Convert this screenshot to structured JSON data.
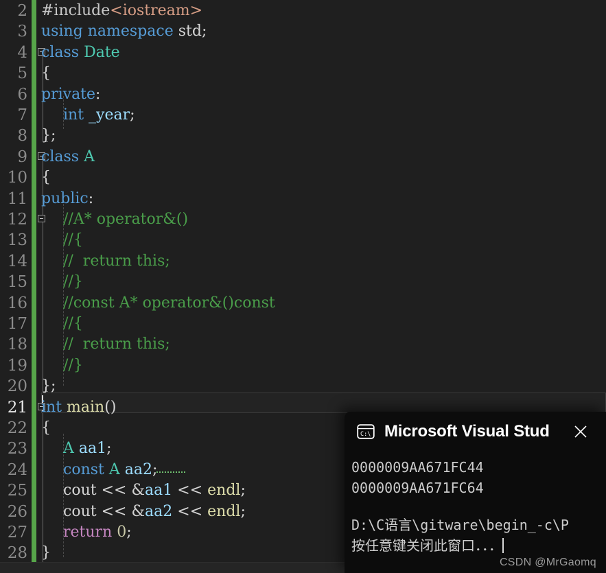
{
  "editor": {
    "background_color": "#1f1f1f",
    "change_bar_color": "#57a64a",
    "current_line": 21,
    "first_visible_line": 2,
    "last_visible_line": 28,
    "lines": [
      {
        "number": "2",
        "indent": 0,
        "tokens": [
          {
            "t": "#include",
            "c": "t-macro"
          },
          {
            "t": "<iostream>",
            "c": "t-str"
          }
        ]
      },
      {
        "number": "3",
        "indent": 0,
        "tokens": [
          {
            "t": "using",
            "c": "t-kw"
          },
          {
            "t": " ",
            "c": "t-plain"
          },
          {
            "t": "namespace",
            "c": "t-kw"
          },
          {
            "t": " ",
            "c": "t-plain"
          },
          {
            "t": "std",
            "c": "t-plain"
          },
          {
            "t": ";",
            "c": "t-punct"
          }
        ]
      },
      {
        "number": "4",
        "indent": 0,
        "tokens": [
          {
            "t": "class",
            "c": "t-kw"
          },
          {
            "t": " ",
            "c": "t-plain"
          },
          {
            "t": "Date",
            "c": "t-type"
          }
        ]
      },
      {
        "number": "5",
        "indent": 0,
        "tokens": [
          {
            "t": "{",
            "c": "t-punct"
          }
        ]
      },
      {
        "number": "6",
        "indent": 0,
        "tokens": [
          {
            "t": "private",
            "c": "t-kw"
          },
          {
            "t": ":",
            "c": "t-punct"
          }
        ]
      },
      {
        "number": "7",
        "indent": 1,
        "tokens": [
          {
            "t": "int",
            "c": "t-kw"
          },
          {
            "t": " ",
            "c": "t-plain"
          },
          {
            "t": "_year",
            "c": "t-field"
          },
          {
            "t": ";",
            "c": "t-punct"
          }
        ]
      },
      {
        "number": "8",
        "indent": 0,
        "tokens": [
          {
            "t": "};",
            "c": "t-punct"
          }
        ]
      },
      {
        "number": "9",
        "indent": 0,
        "tokens": [
          {
            "t": "class",
            "c": "t-kw"
          },
          {
            "t": " ",
            "c": "t-plain"
          },
          {
            "t": "A",
            "c": "t-type"
          }
        ]
      },
      {
        "number": "10",
        "indent": 0,
        "tokens": [
          {
            "t": "{",
            "c": "t-punct"
          }
        ]
      },
      {
        "number": "11",
        "indent": 0,
        "tokens": [
          {
            "t": "public",
            "c": "t-kw"
          },
          {
            "t": ":",
            "c": "t-punct"
          }
        ]
      },
      {
        "number": "12",
        "indent": 1,
        "tokens": [
          {
            "t": "//A* operator&()",
            "c": "t-comment"
          }
        ]
      },
      {
        "number": "13",
        "indent": 1,
        "tokens": [
          {
            "t": "//{",
            "c": "t-comment"
          }
        ]
      },
      {
        "number": "14",
        "indent": 1,
        "tokens": [
          {
            "t": "//  return this;",
            "c": "t-comment"
          }
        ]
      },
      {
        "number": "15",
        "indent": 1,
        "tokens": [
          {
            "t": "//}",
            "c": "t-comment"
          }
        ]
      },
      {
        "number": "16",
        "indent": 1,
        "tokens": [
          {
            "t": "//const A* operator&()const",
            "c": "t-comment"
          }
        ]
      },
      {
        "number": "17",
        "indent": 1,
        "tokens": [
          {
            "t": "//{",
            "c": "t-comment"
          }
        ]
      },
      {
        "number": "18",
        "indent": 1,
        "tokens": [
          {
            "t": "//  return this;",
            "c": "t-comment"
          }
        ]
      },
      {
        "number": "19",
        "indent": 1,
        "tokens": [
          {
            "t": "//}",
            "c": "t-comment"
          }
        ]
      },
      {
        "number": "20",
        "indent": 0,
        "tokens": [
          {
            "t": "};",
            "c": "t-punct"
          }
        ]
      },
      {
        "number": "21",
        "indent": 0,
        "tokens": [
          {
            "t": "int",
            "c": "t-kw"
          },
          {
            "t": " ",
            "c": "t-plain"
          },
          {
            "t": "main",
            "c": "t-func"
          },
          {
            "t": "()",
            "c": "t-punct"
          }
        ]
      },
      {
        "number": "22",
        "indent": 0,
        "tokens": [
          {
            "t": "{",
            "c": "t-punct"
          }
        ]
      },
      {
        "number": "23",
        "indent": 1,
        "tokens": [
          {
            "t": "A",
            "c": "t-type"
          },
          {
            "t": " ",
            "c": "t-plain"
          },
          {
            "t": "aa1",
            "c": "t-var"
          },
          {
            "t": ";",
            "c": "t-punct"
          }
        ]
      },
      {
        "number": "24",
        "indent": 1,
        "tokens": [
          {
            "t": "const",
            "c": "t-kw"
          },
          {
            "t": " ",
            "c": "t-plain"
          },
          {
            "t": "A",
            "c": "t-type"
          },
          {
            "t": " ",
            "c": "t-plain"
          },
          {
            "t": "aa2",
            "c": "t-var"
          },
          {
            "t": ";",
            "c": "t-punct"
          }
        ]
      },
      {
        "number": "25",
        "indent": 1,
        "tokens": [
          {
            "t": "cout",
            "c": "t-plain"
          },
          {
            "t": " << ",
            "c": "t-punct"
          },
          {
            "t": "&",
            "c": "t-punct"
          },
          {
            "t": "aa1",
            "c": "t-var"
          },
          {
            "t": " << ",
            "c": "t-punct"
          },
          {
            "t": "endl",
            "c": "t-func"
          },
          {
            "t": ";",
            "c": "t-punct"
          }
        ]
      },
      {
        "number": "26",
        "indent": 1,
        "tokens": [
          {
            "t": "cout",
            "c": "t-plain"
          },
          {
            "t": " << ",
            "c": "t-punct"
          },
          {
            "t": "&",
            "c": "t-punct"
          },
          {
            "t": "aa2",
            "c": "t-var"
          },
          {
            "t": " << ",
            "c": "t-punct"
          },
          {
            "t": "endl",
            "c": "t-func"
          },
          {
            "t": ";",
            "c": "t-punct"
          }
        ]
      },
      {
        "number": "27",
        "indent": 1,
        "tokens": [
          {
            "t": "return",
            "c": "t-ctrl"
          },
          {
            "t": " ",
            "c": "t-plain"
          },
          {
            "t": "0",
            "c": "t-num"
          },
          {
            "t": ";",
            "c": "t-punct"
          }
        ]
      },
      {
        "number": "28",
        "indent": 0,
        "tokens": [
          {
            "t": "}",
            "c": "t-punct"
          }
        ]
      }
    ],
    "fold_markers": [
      {
        "line": "4",
        "state": "expanded"
      },
      {
        "line": "9",
        "state": "expanded"
      },
      {
        "line": "12",
        "state": "expanded"
      },
      {
        "line": "21",
        "state": "expanded"
      }
    ],
    "diagnostic": {
      "target": "aa2",
      "line": "24",
      "style": "green-dotted-squiggle"
    }
  },
  "console": {
    "icon": "terminal-icon",
    "icon_label": "C:\\",
    "title": "Microsoft Visual Stud",
    "close_label": "×",
    "lines": [
      "0000009AA671FC44",
      "0000009AA671FC64",
      "",
      "D:\\C语言\\gitware\\begin_-c\\P",
      "按任意键关闭此窗口．．．"
    ],
    "background_color": "#0c0c0c",
    "text_color": "#cccccc"
  },
  "watermark": {
    "text": "CSDN @MrGaomq"
  }
}
